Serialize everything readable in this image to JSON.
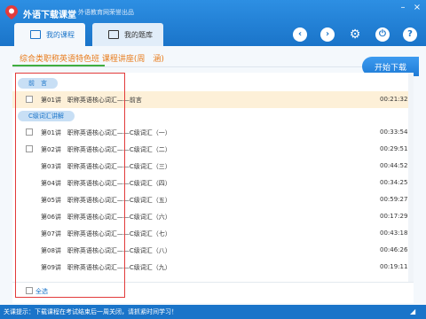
{
  "app": {
    "title": "外语下载课堂",
    "subtitle": "外语教育网荣誉出品"
  },
  "tabs": [
    {
      "label": "我的课程"
    },
    {
      "label": "我的题库"
    }
  ],
  "course": {
    "title": "综合类职称英语特色班 课程讲座(周　涵)",
    "download_button": "开始下载"
  },
  "sections": [
    {
      "label": "前　言"
    },
    {
      "label": "C级词汇讲解"
    }
  ],
  "lessons": [
    {
      "label": "第01讲　职称英语核心词汇——前言",
      "duration": "00:21:32"
    },
    {
      "label": "第01讲　职称英语核心词汇——C级词汇（一）",
      "duration": "00:33:54"
    },
    {
      "label": "第02讲　职称英语核心词汇——C级词汇（二）",
      "duration": "00:29:51"
    },
    {
      "label": "第03讲　职称英语核心词汇——C级词汇（三）",
      "duration": "00:44:52"
    },
    {
      "label": "第04讲　职称英语核心词汇——C级词汇（四）",
      "duration": "00:34:25"
    },
    {
      "label": "第05讲　职称英语核心词汇——C级词汇（五）",
      "duration": "00:59:27"
    },
    {
      "label": "第06讲　职称英语核心词汇——C级词汇（六）",
      "duration": "00:17:29"
    },
    {
      "label": "第07讲　职称英语核心词汇——C级词汇（七）",
      "duration": "00:43:18"
    },
    {
      "label": "第08讲　职称英语核心词汇——C级词汇（八）",
      "duration": "00:46:26"
    },
    {
      "label": "第09讲　职称英语核心词汇——C级词汇（九）",
      "duration": "00:19:11"
    }
  ],
  "select_all": "全选",
  "status": "关课提示：下载课程在考试结束后一周关闭，请抓紧时间学习！",
  "colors": {
    "header": "#1a74c9",
    "accent": "#e87b1b",
    "highlight_box": "#e23b3b",
    "underline": "#3fae3f"
  }
}
